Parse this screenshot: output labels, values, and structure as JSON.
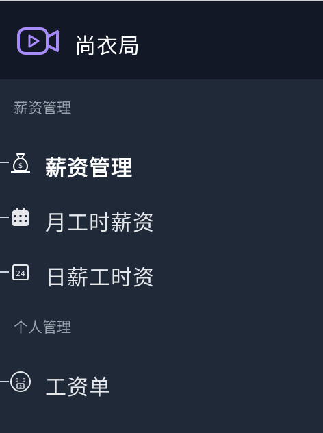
{
  "app": {
    "title": "尚衣局",
    "logo_icon": "video-play-icon",
    "accent": "#a78bfa"
  },
  "groups": [
    {
      "title": "薪资管理",
      "items": [
        {
          "label": "薪资管理",
          "icon": "money-bag-icon",
          "active": true
        },
        {
          "label": "月工时薪资",
          "icon": "calendar-icon",
          "active": false
        },
        {
          "label": "日薪工时资",
          "icon": "calendar-24-icon",
          "active": false
        }
      ]
    },
    {
      "title": "个人管理",
      "items": [
        {
          "label": "工资单",
          "icon": "dollar-coin-icon",
          "active": false
        }
      ]
    }
  ],
  "colors": {
    "sidebar_bg": "#1f2937",
    "header_bg": "#121826",
    "group_text": "#9aa3af"
  }
}
